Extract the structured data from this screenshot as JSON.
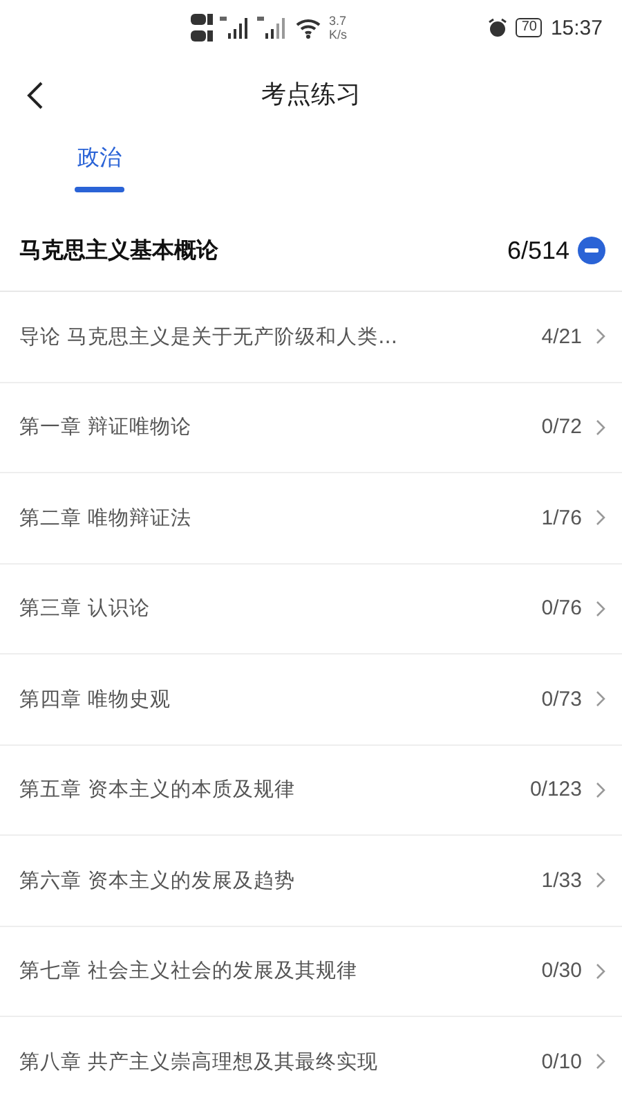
{
  "status_bar": {
    "speed_value": "3.7",
    "speed_unit": "K/s",
    "battery": "70",
    "time": "15:37"
  },
  "header": {
    "title": "考点练习"
  },
  "tabs": [
    {
      "label": "政治",
      "selected": true
    }
  ],
  "section": {
    "title": "马克思主义基本概论",
    "progress": "6/514",
    "expanded": true,
    "chapters": [
      {
        "title": "导论 马克思主义是关于无产阶级和人类...",
        "progress": "4/21"
      },
      {
        "title": "第一章 辩证唯物论",
        "progress": "0/72"
      },
      {
        "title": "第二章 唯物辩证法",
        "progress": "1/76"
      },
      {
        "title": "第三章 认识论",
        "progress": "0/76"
      },
      {
        "title": "第四章 唯物史观",
        "progress": "0/73"
      },
      {
        "title": "第五章 资本主义的本质及规律",
        "progress": "0/123"
      },
      {
        "title": "第六章 资本主义的发展及趋势",
        "progress": "1/33"
      },
      {
        "title": "第七章 社会主义社会的发展及其规律",
        "progress": "0/30"
      },
      {
        "title": "第八章 共产主义崇高理想及其最终实现",
        "progress": "0/10"
      }
    ]
  }
}
